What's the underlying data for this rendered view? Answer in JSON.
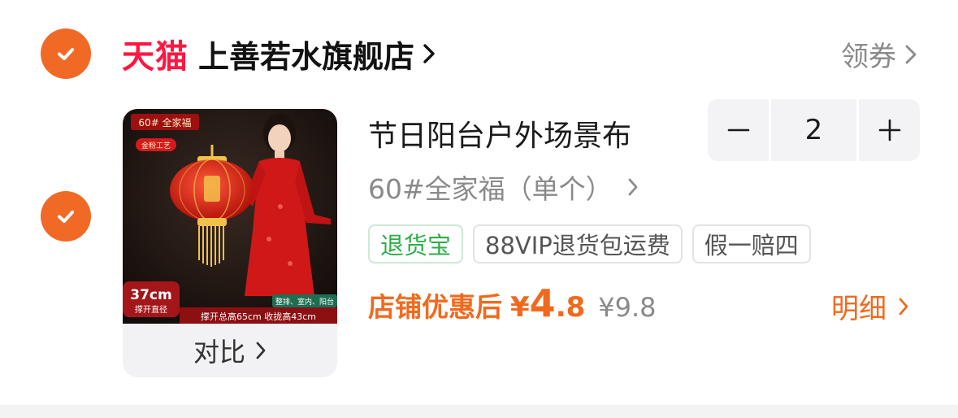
{
  "shop": {
    "brand": "天猫",
    "name": "上善若水旗舰店",
    "coupon_label": "领券"
  },
  "product": {
    "title": "节日阳台户外场景布",
    "sku": "60#全家福（单个）",
    "quantity": "2",
    "tags": [
      "退货宝",
      "88VIP退货包运费",
      "假一赔四"
    ],
    "price_label": "店铺优惠后",
    "price_currency": "¥",
    "price_int": "4",
    "price_dec": ".8",
    "original_price": "¥9.8",
    "detail_label": "明细",
    "compare_label": "对比",
    "image": {
      "badge_top": "60# 全家福",
      "badge_craft": "金粉工艺",
      "size_value": "37cm",
      "size_label": "撑开直径",
      "scene_label": "整排、室内、阳台",
      "dims_label": "撑开总高65cm  收拢高43cm"
    }
  },
  "colors": {
    "accent": "#f06a26",
    "tmall_red": "#ff1742",
    "tag_green": "#2eae49"
  },
  "icons": [
    "check-icon",
    "chevron-right-icon",
    "minus-icon",
    "plus-icon"
  ]
}
